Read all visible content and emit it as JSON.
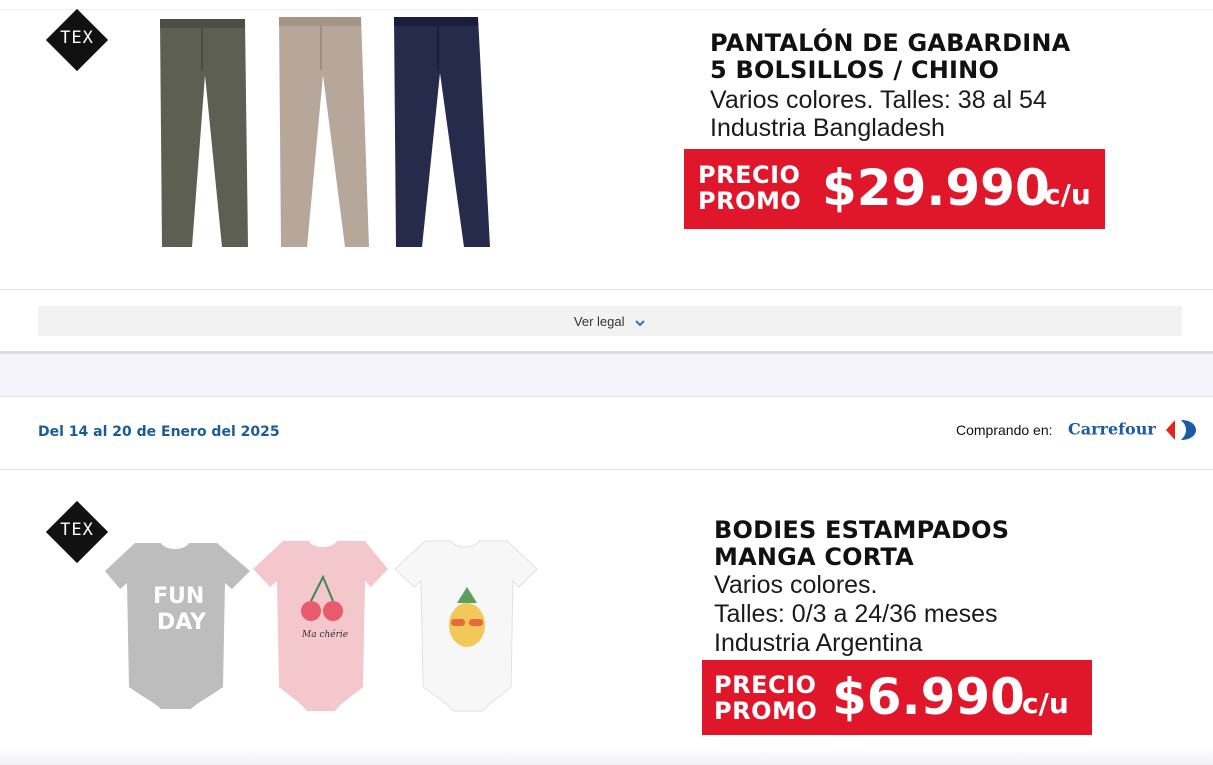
{
  "products": [
    {
      "brand": "TEX",
      "title_line1": "PANTALÓN DE GABARDINA",
      "title_line2": "5 BOLSILLOS / CHINO",
      "desc_line1": "Varios colores. Talles: 38 al 54",
      "desc_line2": "Industria Bangladesh",
      "price_label_1": "PRECIO",
      "price_label_2": "PROMO",
      "price_value": "$29.990",
      "price_unit": "c/u",
      "image_icon": "pants-icon"
    },
    {
      "brand": "TEX",
      "title_line1": "BODIES ESTAMPADOS",
      "title_line2": "MANGA CORTA",
      "desc_line1": "Varios colores.",
      "desc_line2": "Talles: 0/3 a 24/36 meses",
      "desc_line3": "Industria Argentina",
      "price_label_1": "PRECIO",
      "price_label_2": "PROMO",
      "price_value": "$6.990",
      "price_unit": "c/u",
      "image_icon": "baby-bodysuit-icon",
      "bodysuit_prints": [
        "FUN",
        "DAY",
        "Ma chérie"
      ]
    }
  ],
  "legal": {
    "label": "Ver legal",
    "icon": "chevron-down-icon"
  },
  "offer_header": {
    "date_range": "Del 14 al 20 de Enero del 2025",
    "buying_in_label": "Comprando en:",
    "store_name": "Carrefour"
  },
  "colors": {
    "promo_red": "#e0162b",
    "date_blue": "#1a5a9b",
    "carrefour_blue": "#1c5aa6",
    "carrefour_red": "#e1251b"
  }
}
